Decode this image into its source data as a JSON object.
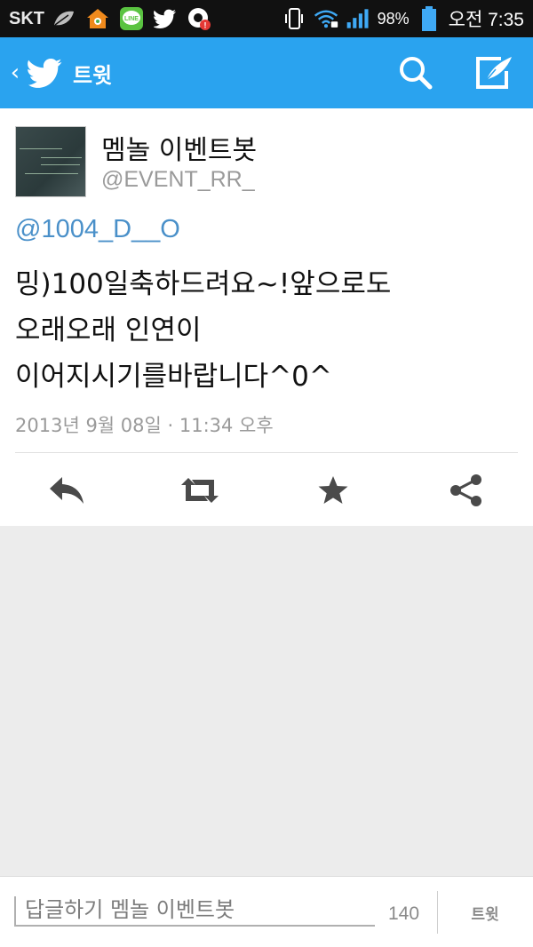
{
  "status_bar": {
    "carrier": "SKT",
    "battery_text": "98%",
    "time": "오전 7:35",
    "icons": [
      "leaf-icon",
      "home-icon",
      "line-app-icon",
      "twitter-bird-icon",
      "record-icon",
      "vibrate-icon",
      "wifi-icon",
      "signal-icon",
      "battery-icon"
    ],
    "line_label": "LINE"
  },
  "app_bar": {
    "title": "트윗",
    "color": "#2aa3ef"
  },
  "tweet": {
    "author_name": "멤놀 이벤트봇",
    "author_handle": "@EVENT_RR_",
    "avatar_text": "멤놀이벤트봇",
    "mention": "@1004_D__O",
    "text_lines": [
      "밍)100일축하드려요~!앞으로도",
      "오래오래 인연이",
      "이어지시기를바랍니다^0^"
    ],
    "timestamp": "2013년 9월 08일 · 11:34 오후"
  },
  "actions": [
    "reply-icon",
    "retweet-icon",
    "favorite-icon",
    "share-icon"
  ],
  "reply_bar": {
    "placeholder": "답글하기 멤놀 이벤트봇",
    "char_count": "140",
    "send_label": "트윗"
  }
}
